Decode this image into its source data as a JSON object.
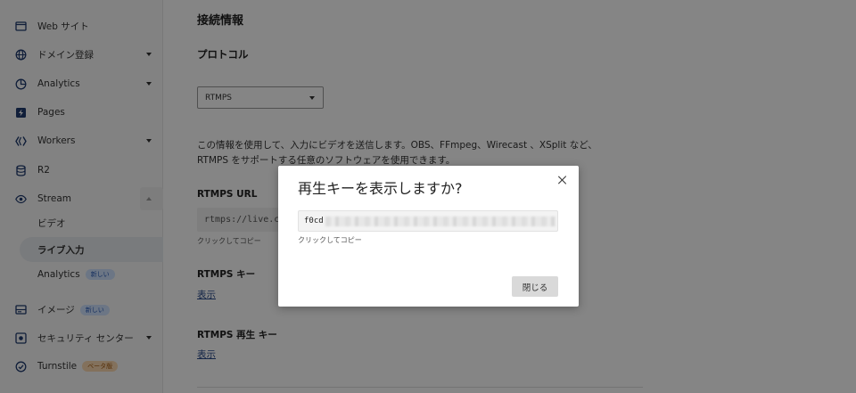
{
  "sidebar": {
    "items": [
      {
        "label": "Web サイト"
      },
      {
        "label": "ドメイン登録"
      },
      {
        "label": "Analytics"
      },
      {
        "label": "Pages"
      },
      {
        "label": "Workers"
      },
      {
        "label": "R2"
      },
      {
        "label": "Stream"
      },
      {
        "label": "イメージ",
        "badge": "新しい"
      },
      {
        "label": "セキュリティ センター"
      },
      {
        "label": "Turnstile",
        "badge": "ベータ版"
      }
    ],
    "stream_sub": [
      {
        "label": "ビデオ"
      },
      {
        "label": "ライブ入力"
      },
      {
        "label": "Analytics",
        "badge": "新しい"
      }
    ]
  },
  "main": {
    "section_title": "接続情報",
    "protocol_label": "プロトコル",
    "protocol_value": "RTMPS",
    "description_line1": "この情報を使用して、入力にビデオを送信します。OBS、FFmpeg、Wirecast 、XSplit など、",
    "description_line2": "RTMPS をサポートする任意のソフトウェアを使用できます。",
    "rtmps_url_label": "RTMPS URL",
    "rtmps_url_value": "rtmps://live.c",
    "copy_hint": "クリックしてコピー",
    "rtmps_key_label": "RTMPS キー",
    "rtmps_key_link": "表示",
    "rtmps_playback_key_label": "RTMPS 再生 キー",
    "rtmps_playback_key_link": "表示"
  },
  "modal": {
    "title": "再生キーを表示しますか?",
    "key_prefix": "f0cd",
    "copy_hint": "クリックしてコピー",
    "close_button": "閉じる"
  }
}
